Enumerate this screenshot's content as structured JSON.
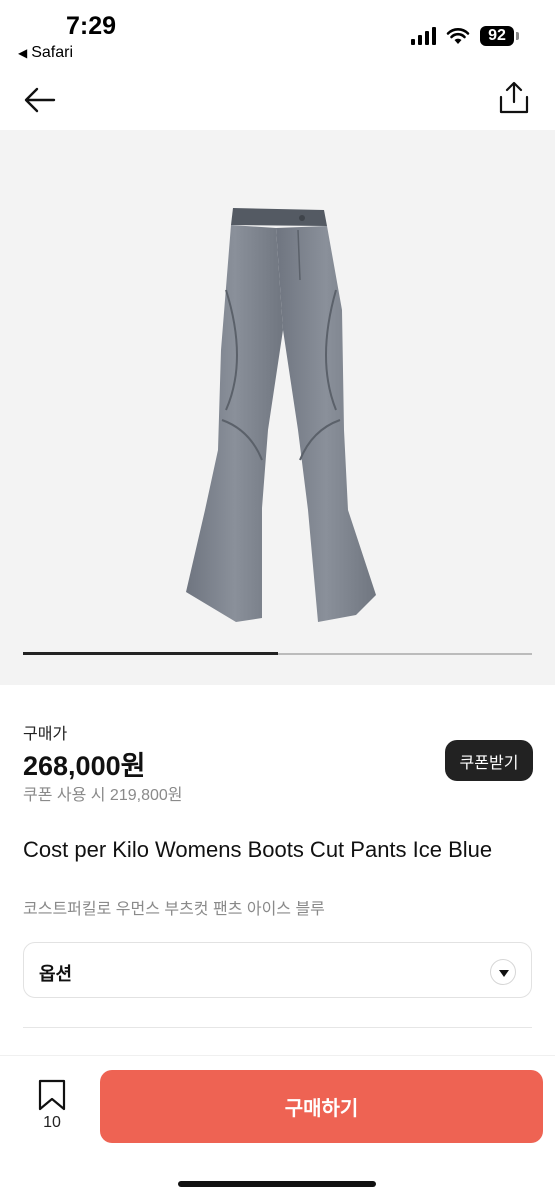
{
  "status_bar": {
    "time": "7:29",
    "back_app": "Safari",
    "back_app_icon": "back-triangle-icon",
    "battery": "92",
    "icons": [
      "signal-icon",
      "wifi-icon",
      "battery-icon"
    ]
  },
  "nav": {
    "back_icon": "arrow-left-icon",
    "share_icon": "share-icon"
  },
  "gallery": {
    "image": "product-photo",
    "progress": 0.5
  },
  "price": {
    "label": "구매가",
    "amount": "268,000원",
    "coupon_text": "쿠폰 사용 시 219,800원",
    "coupon_button": "쿠폰받기"
  },
  "product": {
    "title_en": "Cost per Kilo Womens Boots Cut Pants Ice Blue",
    "title_ko": "코스트퍼킬로 우먼스 부츠컷 팬츠 아이스 블루"
  },
  "option": {
    "label": "옵션",
    "icon": "chevron-down-icon"
  },
  "bottom_bar": {
    "bookmark_icon": "bookmark-icon",
    "bookmark_count": "10",
    "buy_label": "구매하기"
  },
  "colors": {
    "accent": "#ee6353",
    "dark_button": "#222222",
    "muted_text": "#8a8a8a",
    "image_bg": "#f3f3f3"
  }
}
